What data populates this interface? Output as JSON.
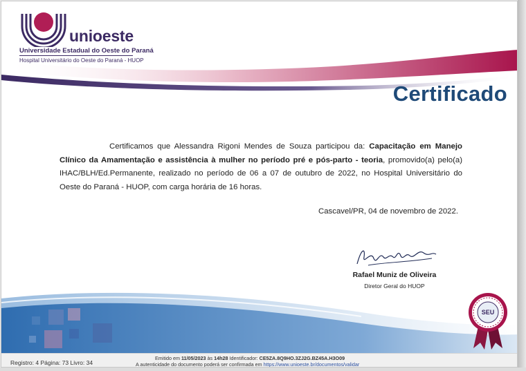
{
  "logo": {
    "word": "unioeste",
    "university": "Universidade Estadual do Oeste do Paraná",
    "hospital": "Hospital Universitário do Oeste do Paraná - HUOP"
  },
  "title": "Certificado",
  "body": {
    "intro": "Certificamos que Alessandra Rigoni Mendes de Souza participou da: ",
    "course": "Capacitação em Manejo Clínico da Amamentação e assistência à mulher no período pré e pós-parto - teoria",
    "rest": ", promovido(a) pelo(a) IHAC/BLH/Ed.Permanente, realizado no período de 06 a 07 de outubro de 2022, no Hospital Universitário do Oeste do Paraná - HUOP, com carga horária de 16 horas."
  },
  "date_line": "Cascavel/PR, 04 de novembro de 2022.",
  "signatory": {
    "name": "Rafael Muniz de Oliveira",
    "role": "Diretor Geral do HUOP"
  },
  "seal": {
    "label": "SEU"
  },
  "footer": {
    "registro": "Registro: 4 Página: 73 Livro: 34",
    "emitido_prefix": "Emitido em ",
    "emitido_date": "11/05/2023",
    "emitido_mid": " às ",
    "emitido_time": "14h28",
    "emitido_id_label": " Identificador: ",
    "emitido_id": "CE5ZA.8Q9HO.3ZJ2G.BZ45A.H3O09",
    "autent_prefix": "A autenticidade do documento poderá ser confirmada em ",
    "autent_link": "https://www.unioeste.br/documentos/validar"
  },
  "colors": {
    "brand_purple": "#3c2a63",
    "brand_magenta": "#b01e55",
    "title_blue": "#1f4a78",
    "wave_blue": "#2f6db0"
  }
}
